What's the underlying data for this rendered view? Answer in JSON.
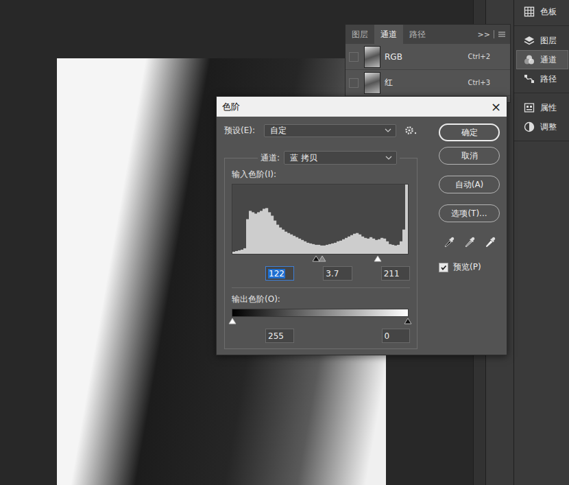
{
  "channels_panel": {
    "tabs": [
      {
        "label": "图层",
        "selected": false
      },
      {
        "label": "通道",
        "selected": true
      },
      {
        "label": "路径",
        "selected": false
      }
    ],
    "collapse": ">>",
    "rows": [
      {
        "name": "RGB",
        "shortcut": "Ctrl+2",
        "visible": false
      },
      {
        "name": "红",
        "shortcut": "Ctrl+3",
        "visible": false
      }
    ]
  },
  "dock": {
    "groups": [
      [
        {
          "label": "色板",
          "selected": false
        }
      ],
      [
        {
          "label": "图层",
          "selected": false
        },
        {
          "label": "通道",
          "selected": true
        },
        {
          "label": "路径",
          "selected": false
        }
      ],
      [
        {
          "label": "属性",
          "selected": false
        },
        {
          "label": "调整",
          "selected": false
        }
      ]
    ]
  },
  "dialog": {
    "title": "色阶",
    "close": "×",
    "preset": {
      "label": "预设(E):",
      "value": "自定"
    },
    "channel": {
      "label": "通道:",
      "value": "蓝 拷贝"
    },
    "input": {
      "label": "输入色阶(I):",
      "histogram": [
        3,
        4,
        5,
        6,
        8,
        50,
        62,
        60,
        58,
        60,
        62,
        65,
        66,
        60,
        55,
        48,
        42,
        38,
        35,
        32,
        30,
        28,
        26,
        24,
        22,
        20,
        18,
        16,
        15,
        14,
        13,
        13,
        12,
        12,
        13,
        14,
        15,
        16,
        18,
        19,
        21,
        23,
        25,
        27,
        29,
        30,
        28,
        25,
        23,
        22,
        24,
        22,
        20,
        21,
        23,
        22,
        18,
        14,
        13,
        12,
        13,
        18,
        35,
        100
      ],
      "sliders": [
        {
          "level": 0.478,
          "color": "#111111"
        },
        {
          "level": 0.512,
          "color": "#808080"
        },
        {
          "level": 0.827,
          "color": "#ffffff"
        }
      ],
      "fields": [
        {
          "value": "122",
          "selected": true
        },
        {
          "value": "3.7",
          "selected": false
        },
        {
          "value": "211",
          "selected": false
        }
      ]
    },
    "output": {
      "label": "输出色阶(O):",
      "sliders": [
        {
          "level": 0,
          "color": "#ffffff"
        },
        {
          "level": 1,
          "color": "#111111"
        }
      ],
      "fields": [
        {
          "value": "255",
          "selected": false
        },
        {
          "value": "0",
          "selected": false
        }
      ]
    },
    "buttons": [
      {
        "label": "确定",
        "default": true
      },
      {
        "label": "取消",
        "default": false
      },
      {
        "label": "自动(A)",
        "default": false
      },
      {
        "label": "选项(T)...",
        "default": false
      }
    ],
    "eyedroppers": [
      {
        "color": "#111111"
      },
      {
        "color": "#8a8a8a"
      },
      {
        "color": "#ffffff"
      }
    ],
    "preview": {
      "label": "预览(P)",
      "checked": true
    }
  }
}
